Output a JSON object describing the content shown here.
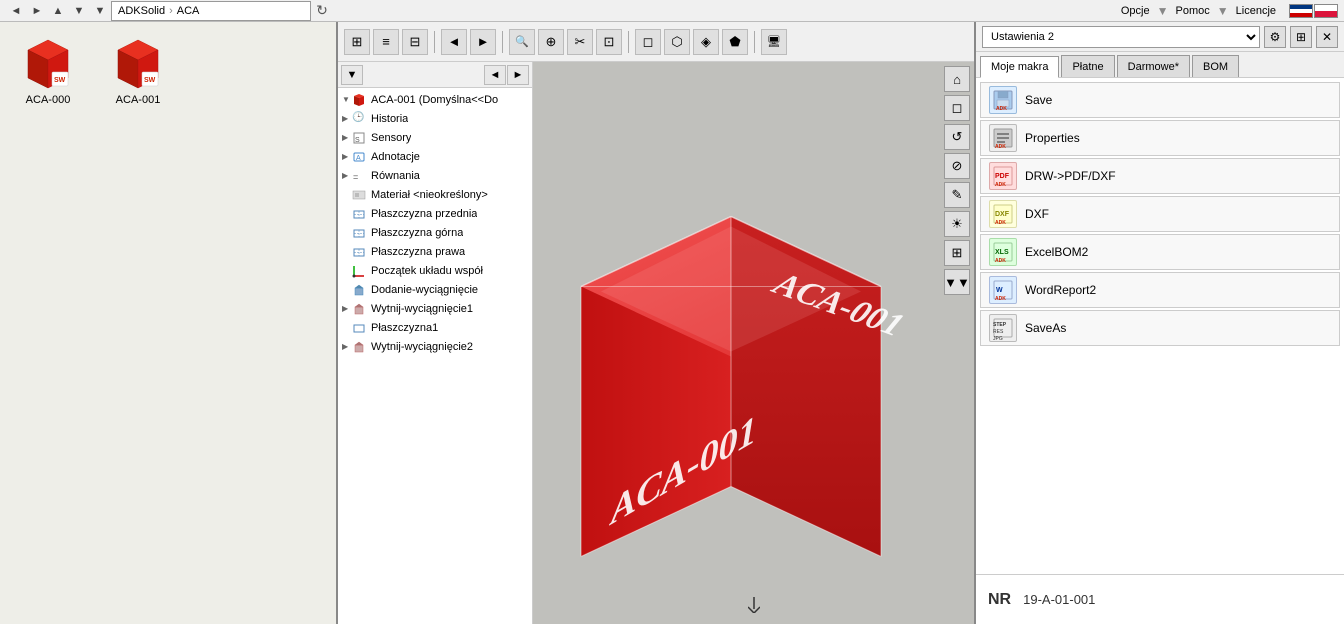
{
  "titlebar": {
    "text": "ADKSolid"
  },
  "menubar": {
    "items": [
      {
        "label": "Opcje",
        "id": "opcje"
      },
      {
        "label": "Pomoc",
        "id": "pomoc"
      },
      {
        "label": "Licencje",
        "id": "licencje"
      }
    ]
  },
  "navbar": {
    "back": "◄",
    "forward": "►",
    "up": "▲",
    "down": "▼",
    "breadcrumb": [
      "ADKSolid",
      "ACA"
    ],
    "refresh": "↻"
  },
  "filebrowser": {
    "items": [
      {
        "name": "ACA-000",
        "label": "ACA-000"
      },
      {
        "name": "ACA-001",
        "label": "ACA-001"
      }
    ]
  },
  "featuretree": {
    "root": "ACA-001 (Domyślna<<Do",
    "items": [
      {
        "label": "Historia",
        "indent": 1,
        "arrow": "▶",
        "icon": "clock"
      },
      {
        "label": "Sensory",
        "indent": 1,
        "arrow": "▶",
        "icon": "sensor"
      },
      {
        "label": "Adnotacje",
        "indent": 1,
        "arrow": "▶",
        "icon": "annotation"
      },
      {
        "label": "Równania",
        "indent": 1,
        "arrow": "▶",
        "icon": "equation"
      },
      {
        "label": "Materiał <nieokreślony>",
        "indent": 1,
        "arrow": "",
        "icon": "material"
      },
      {
        "label": "Płaszczyzna przednia",
        "indent": 1,
        "arrow": "",
        "icon": "plane"
      },
      {
        "label": "Płaszczyzna górna",
        "indent": 1,
        "arrow": "",
        "icon": "plane"
      },
      {
        "label": "Płaszczyzna prawa",
        "indent": 1,
        "arrow": "",
        "icon": "plane"
      },
      {
        "label": "Początek układu współ",
        "indent": 1,
        "arrow": "",
        "icon": "origin"
      },
      {
        "label": "Dodanie-wyciągnięcie",
        "indent": 1,
        "arrow": "",
        "icon": "feature"
      },
      {
        "label": "Wytnij-wyciągnięcie1",
        "indent": 1,
        "arrow": "▶",
        "icon": "cut"
      },
      {
        "label": "Płaszczyzna1",
        "indent": 2,
        "arrow": "",
        "icon": "plane"
      },
      {
        "label": "Wytnij-wyciągnięcie2",
        "indent": 1,
        "arrow": "▶",
        "icon": "cut"
      }
    ]
  },
  "toolbar": {
    "buttons": [
      {
        "icon": "⊞",
        "label": "grid-view"
      },
      {
        "icon": "≡",
        "label": "list-view"
      },
      {
        "icon": "⊟",
        "label": "detail-view"
      },
      {
        "icon": "◄",
        "label": "scroll-left"
      },
      {
        "icon": "►",
        "label": "scroll-right"
      },
      {
        "icon": "🔍",
        "label": "zoom"
      },
      {
        "icon": "⊕",
        "label": "zoom-in"
      },
      {
        "icon": "✂",
        "label": "cut"
      },
      {
        "icon": "⊡",
        "label": "box"
      },
      {
        "icon": "◻",
        "label": "shape"
      },
      {
        "icon": "⬡",
        "label": "view"
      },
      {
        "icon": "◈",
        "label": "render"
      },
      {
        "icon": "🖥",
        "label": "display"
      }
    ]
  },
  "viewport": {
    "cube_label1": "ACA-001",
    "cube_label2": "ACA-001"
  },
  "macros": {
    "top_menu": [
      {
        "label": "Opcje"
      },
      {
        "label": "Pomoc"
      },
      {
        "label": "Licencje"
      }
    ],
    "settings_value": "Ustawienia 2",
    "tabs": [
      {
        "label": "Moje makra",
        "active": true
      },
      {
        "label": "Płatne"
      },
      {
        "label": "Darmowe*"
      },
      {
        "label": "BOM"
      }
    ],
    "items": [
      {
        "label": "Save",
        "icon_type": "save"
      },
      {
        "label": "Properties",
        "icon_type": "props"
      },
      {
        "label": "DRW->PDF/DXF",
        "icon_type": "pdf"
      },
      {
        "label": "DXF",
        "icon_type": "dxf"
      },
      {
        "label": "ExcelBOM2",
        "icon_type": "xls"
      },
      {
        "label": "WordReport2",
        "icon_type": "word"
      },
      {
        "label": "SaveAs",
        "icon_type": "step"
      }
    ],
    "nr_label": "NR",
    "nr_value": "19-A-01-001"
  }
}
